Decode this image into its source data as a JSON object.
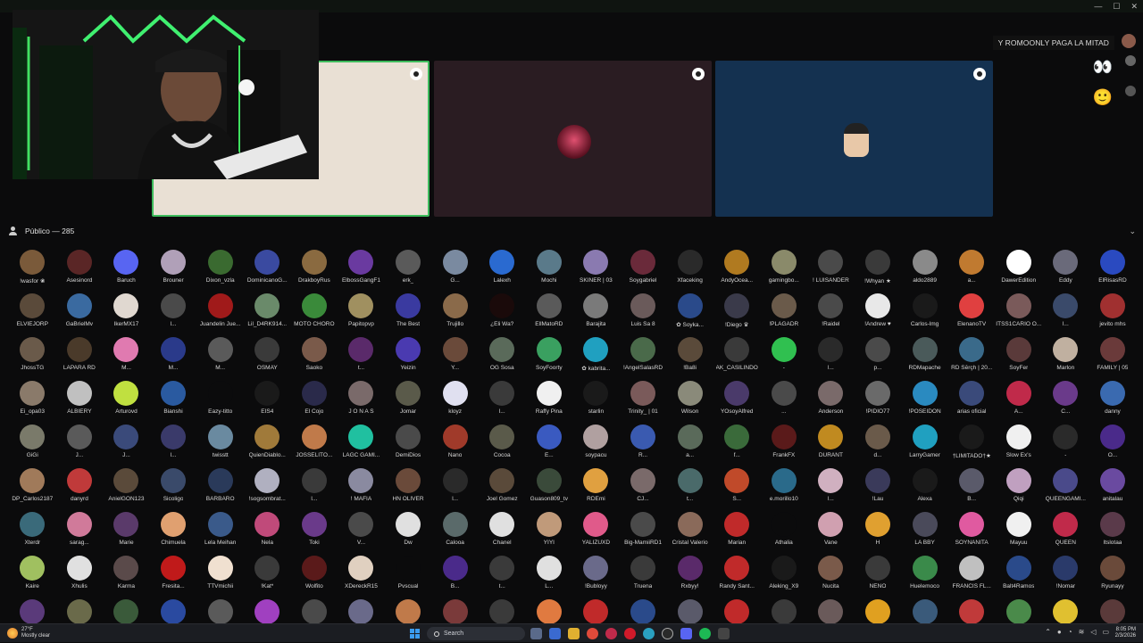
{
  "stage": {
    "banner": "Y ROMOONLY PAGA LA MITAD",
    "tiles": [
      {
        "bg": "#e9e0d4",
        "border": "#3dbb5c"
      },
      {
        "bg": "#2a1c22",
        "border": "#2a1c22"
      },
      {
        "bg": "#143150",
        "border": "#143150"
      }
    ]
  },
  "public": {
    "label": "Público — 285"
  },
  "members": [
    {
      "name": "!wasfor ❀",
      "color": "#7a5a3a"
    },
    {
      "name": "Asesinord",
      "color": "#5a2626"
    },
    {
      "name": "Baruch",
      "color": "#5865f2"
    },
    {
      "name": "Brouner",
      "color": "#b0a0b8"
    },
    {
      "name": "Dixon_vzla",
      "color": "#3a6a30"
    },
    {
      "name": "DominicanoG...",
      "color": "#3a4aa0"
    },
    {
      "name": "DrakboyRus",
      "color": "#8a6a40"
    },
    {
      "name": "ElbossGangF1",
      "color": "#6a3aa0"
    },
    {
      "name": "erk_",
      "color": "#5a5a5a"
    },
    {
      "name": "G...",
      "color": "#7a8aa0"
    },
    {
      "name": "Lalexh",
      "color": "#2a6ad0"
    },
    {
      "name": "Mochi",
      "color": "#5a7a8a"
    },
    {
      "name": "SKINER | 03",
      "color": "#8a7ab0"
    },
    {
      "name": "Soygabriel",
      "color": "#6a2a3a"
    },
    {
      "name": "Xfaceking",
      "color": "#2a2a2a"
    },
    {
      "name": "AndyOcea...",
      "color": "#b07a20"
    },
    {
      "name": "gamingbo...",
      "color": "#8a8a6a"
    },
    {
      "name": "! LUISANDER",
      "color": "#4a4a4a"
    },
    {
      "name": "!Whyan ★",
      "color": "#3a3a3a"
    },
    {
      "name": "aldo2889",
      "color": "#8a8a8a"
    },
    {
      "name": "a...",
      "color": "#c07a30"
    },
    {
      "name": "DawerEdition",
      "color": "#ffffff"
    },
    {
      "name": "Eddy",
      "color": "#6a6a7a"
    },
    {
      "name": "ElRisasRD",
      "color": "#2a4ac0"
    },
    {
      "name": "ELVIEJORP",
      "color": "#5a4a3a"
    },
    {
      "name": "GaBrielMv",
      "color": "#3a6aa0"
    },
    {
      "name": "IkerMX17",
      "color": "#e0d8d0"
    },
    {
      "name": "l...",
      "color": "#4a4a4a"
    },
    {
      "name": "Juandelin Jue...",
      "color": "#a01a1a"
    },
    {
      "name": "Lil_D4RK914...",
      "color": "#6a8a6a"
    },
    {
      "name": "MOTO CHORO",
      "color": "#3a8a3a"
    },
    {
      "name": "Papitopvp",
      "color": "#a09060"
    },
    {
      "name": "The Best",
      "color": "#3a3aa0"
    },
    {
      "name": "Trujillo",
      "color": "#8a6a4a"
    },
    {
      "name": "¿Eli Wa?",
      "color": "#1a0a0a"
    },
    {
      "name": "EllMatoRD",
      "color": "#5a5a5a"
    },
    {
      "name": "Barajita",
      "color": "#7a7a7a"
    },
    {
      "name": "Luis Sa 8",
      "color": "#6a5a5a"
    },
    {
      "name": "✿ Soyka...",
      "color": "#2a4a8a"
    },
    {
      "name": "!Diego ♛",
      "color": "#3a3a4a"
    },
    {
      "name": "!PLAGADR",
      "color": "#6a5a4a"
    },
    {
      "name": "!Raidel",
      "color": "#4a4a4a"
    },
    {
      "name": "!Andrew ♥",
      "color": "#e8e8e8"
    },
    {
      "name": "Carlos-lmg",
      "color": "#1a1a1a"
    },
    {
      "name": "ElenanoTV",
      "color": "#e04040"
    },
    {
      "name": "ITSS1CARIO O...",
      "color": "#7a5a5a"
    },
    {
      "name": "l...",
      "color": "#3a4a6a"
    },
    {
      "name": "jevito mhs",
      "color": "#a03030"
    },
    {
      "name": "JhossTG",
      "color": "#6a5a4a"
    },
    {
      "name": "LAPARA RD",
      "color": "#4a3a2a"
    },
    {
      "name": "M...",
      "color": "#e07ab0"
    },
    {
      "name": "M...",
      "color": "#2a3a8a"
    },
    {
      "name": "M...",
      "color": "#5a5a5a"
    },
    {
      "name": "OSMAY",
      "color": "#3a3a3a"
    },
    {
      "name": "Saoko",
      "color": "#7a5a4a"
    },
    {
      "name": "t...",
      "color": "#5a2a6a"
    },
    {
      "name": "Yeizin",
      "color": "#4a3ab0"
    },
    {
      "name": "Y...",
      "color": "#6a4a3a"
    },
    {
      "name": "OG Sosa",
      "color": "#5a6a5a"
    },
    {
      "name": "SoyFoorty",
      "color": "#3aa060"
    },
    {
      "name": "✿ kabrita...",
      "color": "#20a0c0"
    },
    {
      "name": "!AngelSalasRD",
      "color": "#4a6a4a"
    },
    {
      "name": "!Ba8i",
      "color": "#5a4a3a"
    },
    {
      "name": "AK_CASILINDO",
      "color": "#3a3a3a"
    },
    {
      "name": "-",
      "color": "#30c050"
    },
    {
      "name": "l...",
      "color": "#2a2a2a"
    },
    {
      "name": "p...",
      "color": "#4a4a4a"
    },
    {
      "name": "RDMapache",
      "color": "#4a5a5a"
    },
    {
      "name": "RD Šērçh | 20...",
      "color": "#3a6a8a"
    },
    {
      "name": "SoyFer",
      "color": "#5a3a3a"
    },
    {
      "name": "Marlon",
      "color": "#c0b0a0"
    },
    {
      "name": "FAMILY | 05",
      "color": "#6a3a3a"
    },
    {
      "name": "Ei_opa03",
      "color": "#8a7a6a"
    },
    {
      "name": "ALBIERY",
      "color": "#c0c0c0"
    },
    {
      "name": "Arturovd",
      "color": "#c0e040"
    },
    {
      "name": "Bianshi",
      "color": "#2a5aa0"
    },
    {
      "name": "Eazy-titto",
      "color": "#0b0b0c"
    },
    {
      "name": "EIS4",
      "color": "#1a1a1a"
    },
    {
      "name": "El Cojo",
      "color": "#2a2a4a"
    },
    {
      "name": "J O N A S",
      "color": "#7a6a6a"
    },
    {
      "name": "Jomar",
      "color": "#5a5a4a"
    },
    {
      "name": "kloyz",
      "color": "#e0e0f0"
    },
    {
      "name": "l...",
      "color": "#3a3a3a"
    },
    {
      "name": "Raffy Pina",
      "color": "#f0f0f0"
    },
    {
      "name": "starlin",
      "color": "#1a1a1a"
    },
    {
      "name": "Trinity_ | 01",
      "color": "#7a5a5a"
    },
    {
      "name": "Wilson",
      "color": "#8a8a7a"
    },
    {
      "name": "YOsoyAlfred",
      "color": "#4a3a6a"
    },
    {
      "name": "...",
      "color": "#4a4a4a"
    },
    {
      "name": "Anderson",
      "color": "#7a6a6a"
    },
    {
      "name": "!PIDIO77",
      "color": "#6a6a6a"
    },
    {
      "name": "!POSEIDON",
      "color": "#2a8ac0"
    },
    {
      "name": "arias oficial",
      "color": "#3a4a7a"
    },
    {
      "name": "A...",
      "color": "#c02a4a"
    },
    {
      "name": "C...",
      "color": "#6a3a8a"
    },
    {
      "name": "danny",
      "color": "#3a6ab0"
    },
    {
      "name": "GiGi",
      "color": "#7a7a6a"
    },
    {
      "name": "J...",
      "color": "#5a5a5a"
    },
    {
      "name": "J...",
      "color": "#3a4a7a"
    },
    {
      "name": "l...",
      "color": "#3a3a6a"
    },
    {
      "name": "twisstt",
      "color": "#6a8aa0"
    },
    {
      "name": "QuienDiablo...",
      "color": "#a07a3a"
    },
    {
      "name": "JOSSELITO...",
      "color": "#c07a4a"
    },
    {
      "name": "LAGC GAMI...",
      "color": "#20c0a0"
    },
    {
      "name": "DemiDios",
      "color": "#4a4a4a"
    },
    {
      "name": "Nano",
      "color": "#a03a2a"
    },
    {
      "name": "Cocoa",
      "color": "#5a5a4a"
    },
    {
      "name": "E...",
      "color": "#3a5ac0"
    },
    {
      "name": "soypacu",
      "color": "#b0a0a0"
    },
    {
      "name": "R...",
      "color": "#3a5ab0"
    },
    {
      "name": "a...",
      "color": "#5a6a5a"
    },
    {
      "name": "f...",
      "color": "#3a6a3a"
    },
    {
      "name": "FrankFX",
      "color": "#5a1a1a"
    },
    {
      "name": "DURANT",
      "color": "#c08a20"
    },
    {
      "name": "d...",
      "color": "#6a5a4a"
    },
    {
      "name": "LarryGamer",
      "color": "#20a0c0"
    },
    {
      "name": "†LIMITADO†★",
      "color": "#1a1a1a"
    },
    {
      "name": "Slow Ex's",
      "color": "#f0f0f0"
    },
    {
      "name": "-",
      "color": "#2a2a2a"
    },
    {
      "name": "O...",
      "color": "#4a2a8a"
    },
    {
      "name": "DP_Carlos2187",
      "color": "#a07a5a"
    },
    {
      "name": "danyrd",
      "color": "#c03a3a"
    },
    {
      "name": "AnielGON123",
      "color": "#5a4a3a"
    },
    {
      "name": "Sicoligo",
      "color": "#3a4a6a"
    },
    {
      "name": "BARBARO",
      "color": "#2a3a5a"
    },
    {
      "name": "!sogsombrat...",
      "color": "#b0b0c0"
    },
    {
      "name": "l...",
      "color": "#3a3a3a"
    },
    {
      "name": "! MAFIA",
      "color": "#8a8aa0"
    },
    {
      "name": "HN OLIVER",
      "color": "#6a4a3a"
    },
    {
      "name": "l...",
      "color": "#2a2a2a"
    },
    {
      "name": "Joel Gomez",
      "color": "#5a4a3a"
    },
    {
      "name": "Guason809_tv",
      "color": "#3a4a3a"
    },
    {
      "name": "RDEmi",
      "color": "#e0a040"
    },
    {
      "name": "CJ...",
      "color": "#7a6a6a"
    },
    {
      "name": "t...",
      "color": "#4a6a6a"
    },
    {
      "name": "S...",
      "color": "#c04a2a"
    },
    {
      "name": "e.morillo10",
      "color": "#2a6a8a"
    },
    {
      "name": "l...",
      "color": "#d0b0c0"
    },
    {
      "name": "!Lau",
      "color": "#3a3a5a"
    },
    {
      "name": "Alexa",
      "color": "#1a1a1a"
    },
    {
      "name": "B...",
      "color": "#5a5a6a"
    },
    {
      "name": "Qiqi",
      "color": "#c0a0c0"
    },
    {
      "name": "QUEENGAMI...",
      "color": "#4a4a8a"
    },
    {
      "name": "anitalau",
      "color": "#6a4aa0"
    },
    {
      "name": "Xterdr",
      "color": "#3a6a7a"
    },
    {
      "name": "sarag...",
      "color": "#d07a9a"
    },
    {
      "name": "Marie",
      "color": "#5a3a6a"
    },
    {
      "name": "Chimuela",
      "color": "#e0a070"
    },
    {
      "name": "Lela Meihan",
      "color": "#3a5a8a"
    },
    {
      "name": "Nela",
      "color": "#c04a7a"
    },
    {
      "name": "Toki",
      "color": "#6a3a8a"
    },
    {
      "name": "V...",
      "color": "#4a4a4a"
    },
    {
      "name": "Dw",
      "color": "#e0e0e0"
    },
    {
      "name": "Calooa",
      "color": "#5a6a6a"
    },
    {
      "name": "Chanel",
      "color": "#e0e0e0"
    },
    {
      "name": "YIYI",
      "color": "#c09a7a"
    },
    {
      "name": "YALIZUXD",
      "color": "#e05a8a"
    },
    {
      "name": "Big-MamiiRD1",
      "color": "#4a4a4a"
    },
    {
      "name": "Cristal Valerio",
      "color": "#8a6a5a"
    },
    {
      "name": "Marian",
      "color": "#c02a2a"
    },
    {
      "name": "Athalia",
      "color": "#0b0b0c"
    },
    {
      "name": "Vane",
      "color": "#d0a0b0"
    },
    {
      "name": "H",
      "color": "#e0a030"
    },
    {
      "name": "LA BBY",
      "color": "#4a4a5a"
    },
    {
      "name": "SOYNANITA",
      "color": "#e05aa0"
    },
    {
      "name": "Mayuu",
      "color": "#f0f0f0"
    },
    {
      "name": "QUEEN",
      "color": "#c02a4a"
    },
    {
      "name": "Itslotaa",
      "color": "#5a3a4a"
    },
    {
      "name": "Kaire",
      "color": "#a0c060"
    },
    {
      "name": "Xhulis",
      "color": "#e0e0e0"
    },
    {
      "name": "Karma",
      "color": "#5a4a4a"
    },
    {
      "name": "Fresita...",
      "color": "#c01a1a"
    },
    {
      "name": "TTVmichii",
      "color": "#f0e0d0"
    },
    {
      "name": "!Kat*",
      "color": "#3a3a3a"
    },
    {
      "name": "Wolfito",
      "color": "#5a1a1a"
    },
    {
      "name": "XDereckR15",
      "color": "#e0d0c0"
    },
    {
      "name": "Pvscual",
      "color": "#0b0b0c"
    },
    {
      "name": "B...",
      "color": "#4a2a8a"
    },
    {
      "name": "t...",
      "color": "#3a3a3a"
    },
    {
      "name": "L...",
      "color": "#e0e0e0"
    },
    {
      "name": "!Bubloyy",
      "color": "#6a6a8a"
    },
    {
      "name": "Truena",
      "color": "#3a3a3a"
    },
    {
      "name": "Rxbyy!",
      "color": "#5a2a6a"
    },
    {
      "name": "Randy Sant...",
      "color": "#c02a2a"
    },
    {
      "name": "Aleking_X9",
      "color": "#1a1a1a"
    },
    {
      "name": "Nucita",
      "color": "#7a5a4a"
    },
    {
      "name": "NENO",
      "color": "#3a3a3a"
    },
    {
      "name": "Huelemoco",
      "color": "#3a8a4a"
    },
    {
      "name": "FRANCIS FL...",
      "color": "#c0c0c0"
    },
    {
      "name": "Balt4Ramos",
      "color": "#2a4a8a"
    },
    {
      "name": "!Nomar",
      "color": "#2a3a6a"
    },
    {
      "name": "Ryunayy",
      "color": "#6a4a3a"
    },
    {
      "name": "",
      "color": "#5a3a7a"
    },
    {
      "name": "",
      "color": "#6a6a4a"
    },
    {
      "name": "",
      "color": "#3a5a3a"
    },
    {
      "name": "",
      "color": "#2a4aa0"
    },
    {
      "name": "",
      "color": "#5a5a5a"
    },
    {
      "name": "",
      "color": "#a040c0"
    },
    {
      "name": "",
      "color": "#4a4a4a"
    },
    {
      "name": "",
      "color": "#6a6a8a"
    },
    {
      "name": "",
      "color": "#c07a4a"
    },
    {
      "name": "",
      "color": "#7a3a3a"
    },
    {
      "name": "",
      "color": "#3a3a3a"
    },
    {
      "name": "",
      "color": "#e07a40"
    },
    {
      "name": "",
      "color": "#c02a2a"
    },
    {
      "name": "",
      "color": "#2a4a8a"
    },
    {
      "name": "",
      "color": "#5a5a6a"
    },
    {
      "name": "",
      "color": "#c02a2a"
    },
    {
      "name": "",
      "color": "#3a3a3a"
    },
    {
      "name": "",
      "color": "#6a5a5a"
    },
    {
      "name": "",
      "color": "#e0a020"
    },
    {
      "name": "",
      "color": "#3a5a7a"
    },
    {
      "name": "",
      "color": "#c03a3a"
    },
    {
      "name": "",
      "color": "#4a8a4a"
    },
    {
      "name": "",
      "color": "#e0c030"
    },
    {
      "name": "",
      "color": "#5a3a3a"
    }
  ],
  "taskbar": {
    "temp": "27°F",
    "weather": "Mostly clear",
    "search": "Search",
    "time": "8:05 PM",
    "date": "2/3/2026"
  }
}
